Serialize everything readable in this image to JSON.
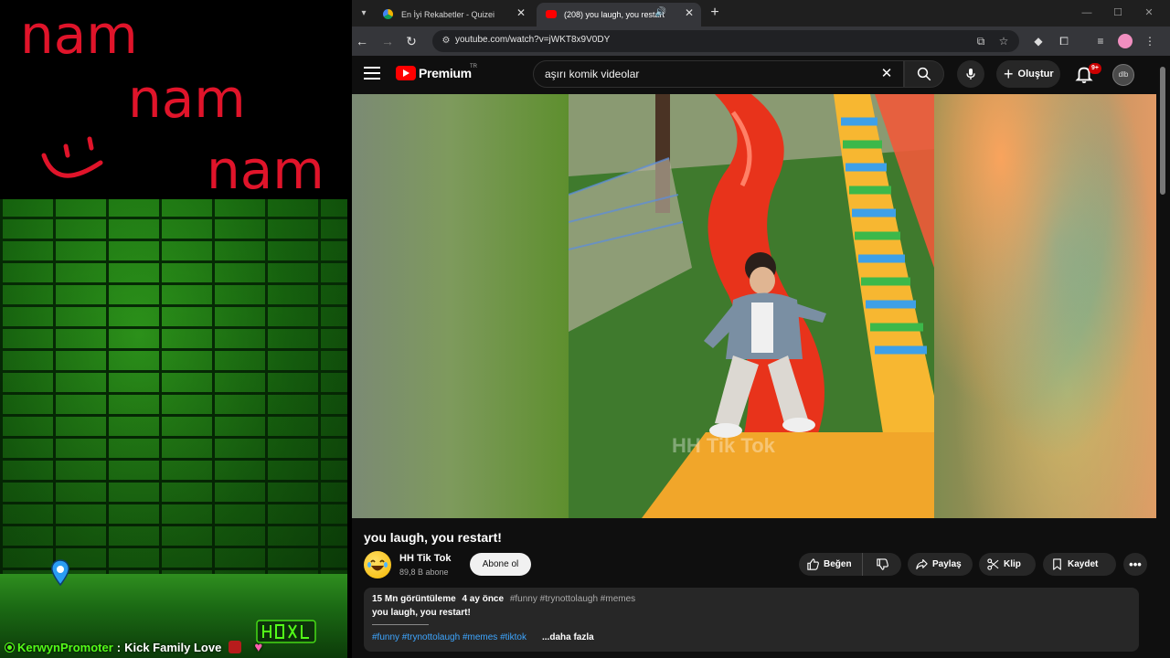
{
  "overlay": {
    "handwriting_lines": [
      "nam",
      "nam",
      "nam"
    ],
    "chat": {
      "username": "KerwynPromoter",
      "separator": ":",
      "message": "Kick Family Love"
    }
  },
  "browser": {
    "tabs": [
      {
        "title": "En İyi Rekabetler - Quizei",
        "active": false
      },
      {
        "title": "(208) you laugh, you restart!",
        "active": true
      }
    ],
    "url": "youtube.com/watch?v=jWKT8x9V0DY"
  },
  "youtube": {
    "brand": "Premium",
    "country": "TR",
    "search_query": "aşırı komik videolar",
    "create_label": "Oluştur",
    "notification_count": "9+",
    "avatar_text": "dlb"
  },
  "video": {
    "title": "you laugh, you restart!",
    "watermark": "HH Tik Tok",
    "channel": {
      "name": "HH Tik Tok",
      "subscribers": "89,8 B abone",
      "subscribe_label": "Abone ol"
    },
    "actions": {
      "like": "Beğen",
      "share": "Paylaş",
      "clip": "Klip",
      "save": "Kaydet"
    },
    "description": {
      "views": "15 Mn görüntüleme",
      "age": "4 ay önce",
      "hashtags": "#funny #trynottolaugh #memes",
      "line": "you laugh, you restart!",
      "tag_line": "#funny #trynottolaugh #memes #tiktok",
      "more_label": "...daha fazla"
    }
  },
  "colors": {
    "youtube_red": "#ff0000",
    "kick_green": "#53fc18",
    "link_blue": "#3ea6ff",
    "handwriting_red": "#e0142a"
  },
  "icons": [
    "search-icon",
    "mic-icon",
    "bell-icon",
    "like-icon",
    "dislike-icon",
    "share-icon",
    "scissors-icon",
    "bookmark-icon",
    "more-icon",
    "pin-icon"
  ]
}
